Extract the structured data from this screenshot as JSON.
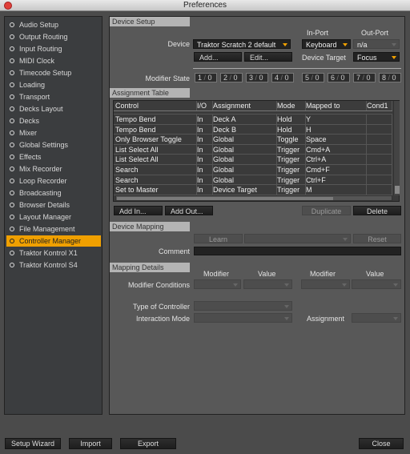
{
  "window": {
    "title": "Preferences"
  },
  "sidebar": {
    "items": [
      "Audio Setup",
      "Output Routing",
      "Input Routing",
      "MIDI Clock",
      "Timecode Setup",
      "Loading",
      "Transport",
      "Decks Layout",
      "Decks",
      "Mixer",
      "Global Settings",
      "Effects",
      "Mix Recorder",
      "Loop Recorder",
      "Broadcasting",
      "Browser Details",
      "Layout Manager",
      "File Management",
      "Controller Manager",
      "Traktor Kontrol X1",
      "Traktor Kontrol S4"
    ],
    "selected": "Controller Manager",
    "accent": "#f0a000"
  },
  "device_setup": {
    "header": "Device Setup",
    "in_port_label": "In-Port",
    "out_port_label": "Out-Port",
    "device_label": "Device",
    "device_value": "Traktor Scratch 2 default",
    "in_port_value": "Keyboard",
    "out_port_value": "n/a",
    "add_button": "Add...",
    "edit_button": "Edit...",
    "device_target_label": "Device Target",
    "device_target_value": "Focus",
    "modifier_state_label": "Modifier State",
    "modifiers": [
      {
        "n": "1",
        "v": "0"
      },
      {
        "n": "2",
        "v": "0"
      },
      {
        "n": "3",
        "v": "0"
      },
      {
        "n": "4",
        "v": "0"
      },
      {
        "n": "5",
        "v": "0"
      },
      {
        "n": "6",
        "v": "0"
      },
      {
        "n": "7",
        "v": "0"
      },
      {
        "n": "8",
        "v": "0"
      }
    ]
  },
  "assignment_table": {
    "header": "Assignment Table",
    "columns": [
      "Control",
      "I/O",
      "Assignment",
      "Mode",
      "Mapped to",
      "Cond1"
    ],
    "rows": [
      [
        "Tempo Bend",
        "In",
        "Deck A",
        "Hold",
        "Y",
        ""
      ],
      [
        "Tempo Bend",
        "In",
        "Deck B",
        "Hold",
        "H",
        ""
      ],
      [
        "Only Browser Toggle",
        "In",
        "Global",
        "Toggle",
        "Space",
        ""
      ],
      [
        "List Select All",
        "In",
        "Global",
        "Trigger",
        "Cmd+A",
        ""
      ],
      [
        "List Select All",
        "In",
        "Global",
        "Trigger",
        "Ctrl+A",
        ""
      ],
      [
        "Search",
        "In",
        "Global",
        "Trigger",
        "Cmd+F",
        ""
      ],
      [
        "Search",
        "In",
        "Global",
        "Trigger",
        "Ctrl+F",
        ""
      ],
      [
        "Set to Master",
        "In",
        "Device Target",
        "Trigger",
        "M",
        ""
      ]
    ],
    "add_in_button": "Add In...",
    "add_out_button": "Add Out...",
    "duplicate_button": "Duplicate",
    "delete_button": "Delete"
  },
  "device_mapping": {
    "header": "Device Mapping",
    "learn_button": "Learn",
    "reset_button": "Reset",
    "comment_label": "Comment",
    "comment_value": ""
  },
  "mapping_details": {
    "header": "Mapping Details",
    "modifier_label": "Modifier",
    "value_label": "Value",
    "modifier_conditions_label": "Modifier Conditions",
    "type_of_controller_label": "Type of Controller",
    "interaction_mode_label": "Interaction Mode",
    "assignment_label": "Assignment"
  },
  "footer": {
    "setup_wizard": "Setup Wizard",
    "import": "Import",
    "export": "Export",
    "close": "Close"
  }
}
